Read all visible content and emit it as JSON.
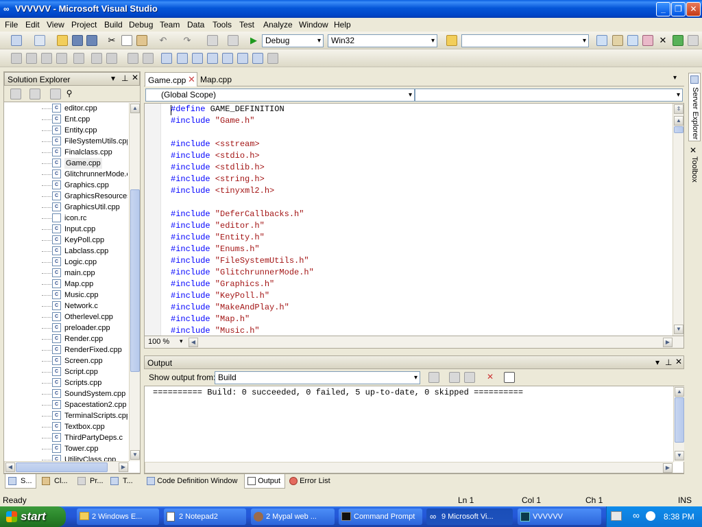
{
  "window": {
    "title": "VVVVVV - Microsoft Visual Studio"
  },
  "menu": [
    "File",
    "Edit",
    "View",
    "Project",
    "Build",
    "Debug",
    "Team",
    "Data",
    "Tools",
    "Test",
    "Analyze",
    "Window",
    "Help"
  ],
  "toolbar": {
    "config": "Debug",
    "platform": "Win32",
    "find": ""
  },
  "solution_explorer": {
    "title": "Solution Explorer",
    "items": [
      "editor.cpp",
      "Ent.cpp",
      "Entity.cpp",
      "FileSystemUtils.cpp",
      "Finalclass.cpp",
      "Game.cpp",
      "GlitchrunnerMode.c",
      "Graphics.cpp",
      "GraphicsResources",
      "GraphicsUtil.cpp",
      "icon.rc",
      "Input.cpp",
      "KeyPoll.cpp",
      "Labclass.cpp",
      "Logic.cpp",
      "main.cpp",
      "Map.cpp",
      "Music.cpp",
      "Network.c",
      "Otherlevel.cpp",
      "preloader.cpp",
      "Render.cpp",
      "RenderFixed.cpp",
      "Screen.cpp",
      "Script.cpp",
      "Scripts.cpp",
      "SoundSystem.cpp",
      "Spacestation2.cpp",
      "TerminalScripts.cpp",
      "Textbox.cpp",
      "ThirdPartyDeps.c",
      "Tower.cpp",
      "UtilityClass.cpp"
    ],
    "selected_index": 5,
    "tabs": [
      "S...",
      "Cl...",
      "Pr...",
      "T..."
    ]
  },
  "editor": {
    "tabs": [
      "Game.cpp",
      "Map.cpp"
    ],
    "scope": "(Global Scope)",
    "zoom": "100 %",
    "lines": [
      {
        "d": "#define",
        "a": " GAME_DEFINITION"
      },
      {
        "d": "#include",
        "a": " \"Game.h\""
      },
      {
        "d": "",
        "a": ""
      },
      {
        "d": "#include",
        "a": " <sstream>"
      },
      {
        "d": "#include",
        "a": " <stdio.h>"
      },
      {
        "d": "#include",
        "a": " <stdlib.h>"
      },
      {
        "d": "#include",
        "a": " <string.h>"
      },
      {
        "d": "#include",
        "a": " <tinyxml2.h>"
      },
      {
        "d": "",
        "a": ""
      },
      {
        "d": "#include",
        "a": " \"DeferCallbacks.h\""
      },
      {
        "d": "#include",
        "a": " \"editor.h\""
      },
      {
        "d": "#include",
        "a": " \"Entity.h\""
      },
      {
        "d": "#include",
        "a": " \"Enums.h\""
      },
      {
        "d": "#include",
        "a": " \"FileSystemUtils.h\""
      },
      {
        "d": "#include",
        "a": " \"GlitchrunnerMode.h\""
      },
      {
        "d": "#include",
        "a": " \"Graphics.h\""
      },
      {
        "d": "#include",
        "a": " \"KeyPoll.h\""
      },
      {
        "d": "#include",
        "a": " \"MakeAndPlay.h\""
      },
      {
        "d": "#include",
        "a": " \"Map.h\""
      },
      {
        "d": "#include",
        "a": " \"Music.h\""
      }
    ]
  },
  "side_tabs": [
    "Server Explorer",
    "Toolbox"
  ],
  "output": {
    "title": "Output",
    "show_from_label": "Show output from:",
    "source": "Build",
    "text": "========== Build: 0 succeeded, 0 failed, 5 up-to-date, 0 skipped =========="
  },
  "bottom_tabs": [
    "Code Definition Window",
    "Output",
    "Error List"
  ],
  "status": {
    "ready": "Ready",
    "ln": "Ln 1",
    "col": "Col 1",
    "ch": "Ch 1",
    "mode": "INS"
  },
  "taskbar": {
    "start": "start",
    "tasks": [
      "2 Windows E...",
      "2 Notepad2",
      "2 Mypal web ...",
      "Command Prompt",
      "9 Microsoft Vi...",
      "VVVVVV"
    ],
    "clock": "8:38 PM"
  }
}
